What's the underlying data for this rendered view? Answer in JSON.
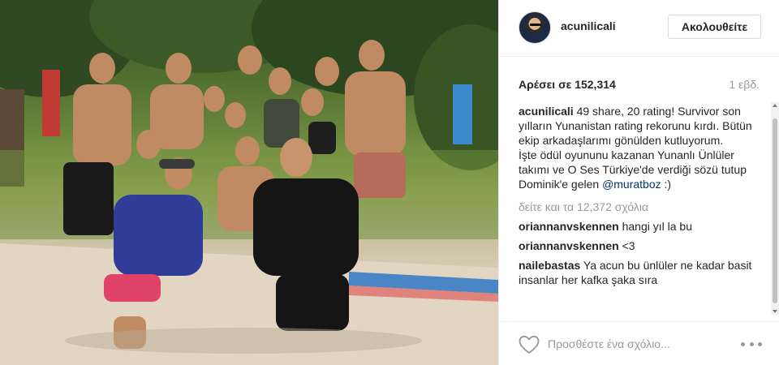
{
  "post": {
    "image_alt": "Group photo of Survivor contestants on a beach",
    "author": "acunilicali",
    "follow_label": "Ακολουθείτε",
    "likes_text": "Αρέσει σε 152,314",
    "time_text": "1 εβδ.",
    "caption_user": "acunilicali",
    "caption_text": " 49 share, 20 rating! Survivor son yılların Yunanistan rating rekorunu kırdı. Bütün ekip arkadaşlarımı gönülden kutluyorum.",
    "caption_text_2": "İşte ödül oyununu kazanan Yunanlı Ünlüler takımı ve O Ses Türkiye'de verdiği sözü tutup Dominik'e gelen ",
    "caption_mention": "@muratboz",
    "caption_end": " :)",
    "more_comments": "δείτε και τα 12,372 σχόλια",
    "comments": [
      {
        "user": "oriannanvskennen",
        "text": " hangi yıl la bu"
      },
      {
        "user": "oriannanvskennen",
        "text": " <3"
      },
      {
        "user": "nailebastas",
        "text": " Ya acun bu ünlüler ne kadar basit insanlar her kafka şaka sıra"
      }
    ],
    "comment_placeholder": "Προσθέστε ένα σχόλιο..."
  },
  "icons": {
    "heart": "heart-icon",
    "more": "more-options-icon",
    "avatar": "avatar"
  }
}
